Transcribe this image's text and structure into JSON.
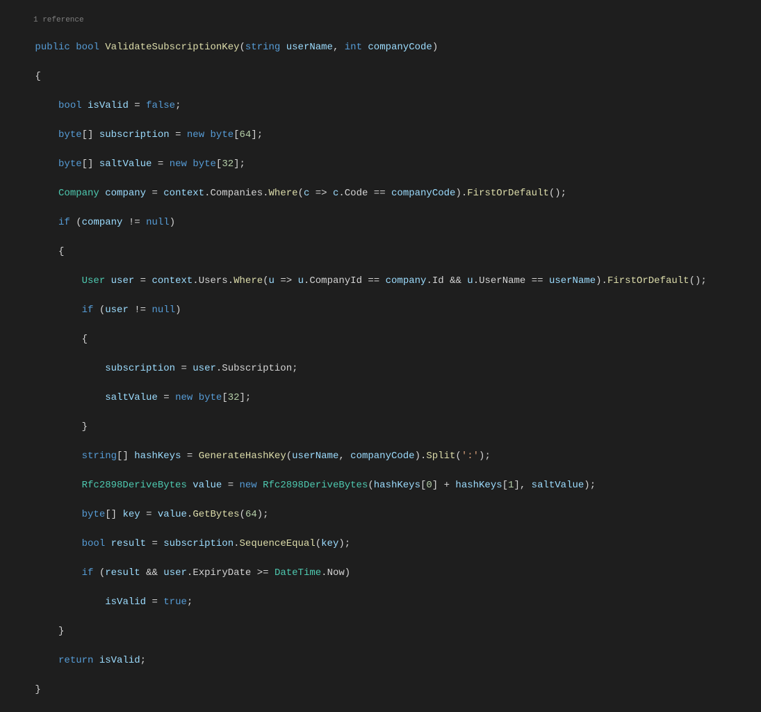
{
  "reference_label": "1 reference",
  "code": {
    "l1": {
      "public": "public",
      "bool": "bool",
      "name": "ValidateSubscriptionKey",
      "p1t": "string",
      "p1n": "userName",
      "p2t": "int",
      "p2n": "companyCode"
    },
    "l2": "{",
    "l3": {
      "bool": "bool",
      "var": "isValid",
      "eq": "=",
      "val": "false"
    },
    "l4": {
      "byte": "byte",
      "br": "[]",
      "var": "subscription",
      "eq": "=",
      "new": "new",
      "byte2": "byte",
      "size": "64"
    },
    "l5": {
      "byte": "byte",
      "br": "[]",
      "var": "saltValue",
      "eq": "=",
      "new": "new",
      "byte2": "byte",
      "size": "32"
    },
    "l6": {
      "type": "Company",
      "var": "company",
      "eq": "=",
      "ctx": "context",
      "comp": "Companies",
      "where": "Where",
      "c": "c",
      "arrow": "=>",
      "c2": "c",
      "code": "Code",
      "eqop": "==",
      "cc": "companyCode",
      "fod": "FirstOrDefault"
    },
    "l7": {
      "if": "if",
      "company": "company",
      "ne": "!=",
      "null": "null"
    },
    "l8": "{",
    "l9": {
      "type": "User",
      "var": "user",
      "eq": "=",
      "ctx": "context",
      "users": "Users",
      "where": "Where",
      "u": "u",
      "arrow": "=>",
      "u2": "u",
      "cid": "CompanyId",
      "eqop": "==",
      "company": "company",
      "id": "Id",
      "and": "&&",
      "u3": "u",
      "un": "UserName",
      "eqop2": "==",
      "userName": "userName",
      "fod": "FirstOrDefault"
    },
    "l10": {
      "if": "if",
      "user": "user",
      "ne": "!=",
      "null": "null"
    },
    "l11": "{",
    "l12": {
      "sub": "subscription",
      "eq": "=",
      "user": "user",
      "Sub": "Subscription"
    },
    "l13": {
      "salt": "saltValue",
      "eq": "=",
      "new": "new",
      "byte": "byte",
      "size": "32"
    },
    "l14": "}",
    "l15": {
      "string": "string",
      "br": "[]",
      "var": "hashKeys",
      "eq": "=",
      "gen": "GenerateHashKey",
      "p1": "userName",
      "p2": "companyCode",
      "split": "Split",
      "ch": "':'"
    },
    "l16": {
      "type": "Rfc2898DeriveBytes",
      "var": "value",
      "eq": "=",
      "new": "new",
      "type2": "Rfc2898DeriveBytes",
      "hk": "hashKeys",
      "i0": "0",
      "plus": "+",
      "hk2": "hashKeys",
      "i1": "1",
      "salt": "saltValue"
    },
    "l17": {
      "byte": "byte",
      "br": "[]",
      "var": "key",
      "eq": "=",
      "value": "value",
      "gb": "GetBytes",
      "n": "64"
    },
    "l18": {
      "bool": "bool",
      "var": "result",
      "eq": "=",
      "sub": "subscription",
      "seq": "SequenceEqual",
      "key": "key"
    },
    "l19": {
      "if": "if",
      "result": "result",
      "and": "&&",
      "user": "user",
      "ed": "ExpiryDate",
      "ge": ">=",
      "dt": "DateTime",
      "now": "Now"
    },
    "l20": {
      "isValid": "isValid",
      "eq": "=",
      "true": "true"
    },
    "l21": "}",
    "l22": {
      "return": "return",
      "isValid": "isValid"
    },
    "l23": "}"
  }
}
